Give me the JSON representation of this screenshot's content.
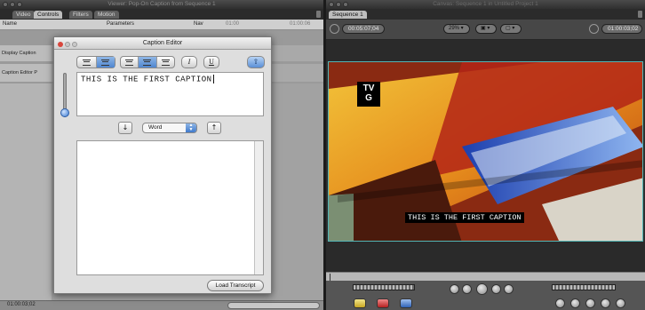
{
  "viewer": {
    "title": "Viewer: Pop-On Caption from Sequence 1",
    "tabs": [
      "Video",
      "Controls",
      "Filters",
      "Motion"
    ],
    "active_tab": "Controls",
    "columns": {
      "name": "Name",
      "parameters": "Parameters",
      "nav": "Nav",
      "time_start": "01:00",
      "time_end": "01:00:06"
    },
    "rows": [
      "Display Caption",
      "Caption Editor P"
    ],
    "timecode": "01:00:03;02"
  },
  "caption_editor": {
    "title": "Caption Editor",
    "caption_text": "THIS IS THE FIRST CAPTION",
    "italic_label": "I",
    "underline_label": "U",
    "search_scope": "Word",
    "load_button": "Load Transcript",
    "up_arrow": "↑",
    "down_arrow": "↓"
  },
  "canvas": {
    "title": "Canvas: Sequence 1 in Untitled Project 1",
    "tab": "Sequence 1",
    "timecode_left": "00:05:07;04",
    "zoom": "29%",
    "timecode_right": "01:00:03;02",
    "rating_t": "T",
    "rating_v": "V",
    "rating_g": "G",
    "caption_overlay": "THIS IS THE FIRST CAPTION"
  },
  "colors": {
    "accent_blue": "#4f86cf",
    "canvas_border": "#53b5b5"
  }
}
